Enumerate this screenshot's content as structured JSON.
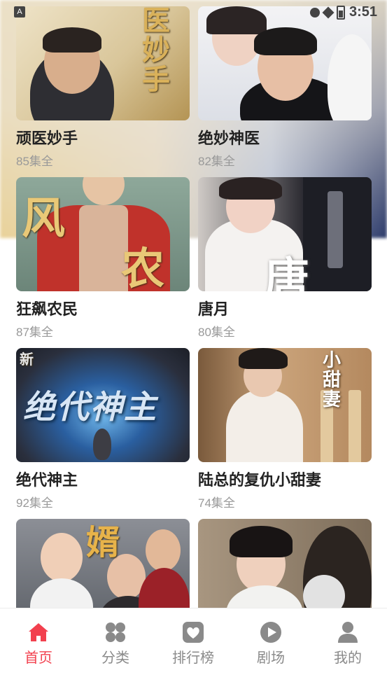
{
  "status_bar": {
    "time": "3:51"
  },
  "dramas": [
    {
      "title": "顽医妙手",
      "episodes": "85集全",
      "poster_text": "医妙手"
    },
    {
      "title": "绝妙神医",
      "episodes": "82集全"
    },
    {
      "title": "狂飙农民",
      "episodes": "87集全",
      "poster_text_a": "风",
      "poster_text_b": "农"
    },
    {
      "title": "唐月",
      "episodes": "80集全",
      "poster_text": "唐"
    },
    {
      "title": "绝代神主",
      "episodes": "92集全",
      "poster_text": "绝代神主",
      "poster_text_small": "新"
    },
    {
      "title": "陆总的复仇小甜妻",
      "episodes": "74集全",
      "poster_text": "小甜妻"
    },
    {
      "title": "",
      "episodes": "",
      "poster_text": "婿"
    },
    {
      "title": "",
      "episodes": ""
    }
  ],
  "tabs": [
    {
      "label": "首页",
      "icon": "home-icon",
      "active": true
    },
    {
      "label": "分类",
      "icon": "grid-icon",
      "active": false
    },
    {
      "label": "排行榜",
      "icon": "heart-badge-icon",
      "active": false
    },
    {
      "label": "剧场",
      "icon": "play-icon",
      "active": false
    },
    {
      "label": "我的",
      "icon": "user-icon",
      "active": false
    }
  ],
  "colors": {
    "accent": "#f2404e",
    "inactive": "#8a8a8a"
  }
}
